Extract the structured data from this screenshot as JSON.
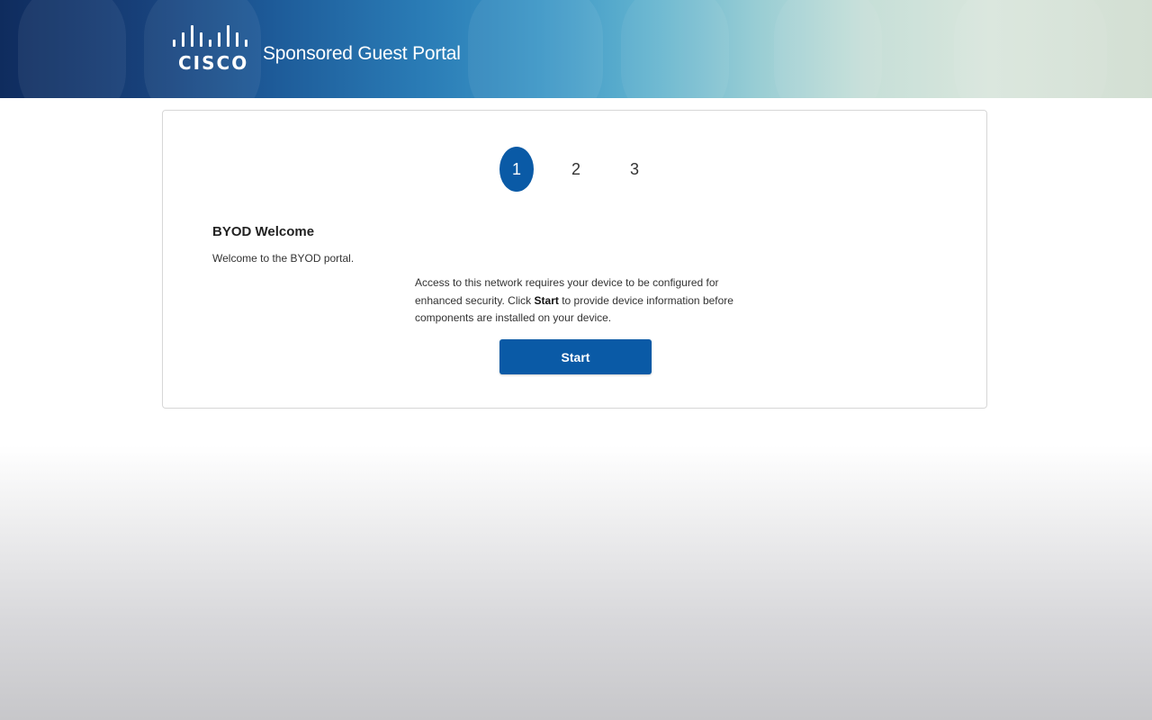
{
  "header": {
    "logo_text": "CISCO",
    "title": "Sponsored Guest Portal"
  },
  "steps": [
    {
      "label": "1",
      "active": true
    },
    {
      "label": "2",
      "active": false
    },
    {
      "label": "3",
      "active": false
    }
  ],
  "content": {
    "title": "BYOD Welcome",
    "subtitle": "Welcome to the BYOD portal.",
    "message_part1": "Access to this network requires your device to be configured for enhanced security. Click ",
    "message_bold": "Start",
    "message_part2": " to provide device information before components are installed on your device.",
    "start_label": "Start"
  },
  "colors": {
    "primary": "#0a5aa6",
    "header_dark": "#0f2c5e",
    "header_light": "#d9e6dc"
  },
  "icons": {
    "logo": "cisco-bridge-logo-icon"
  }
}
